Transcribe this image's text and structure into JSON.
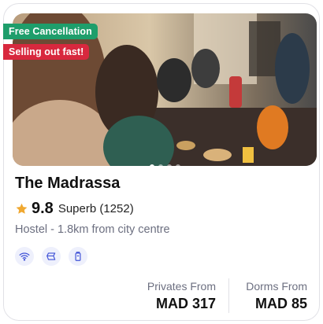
{
  "property": {
    "name": "The Madrassa",
    "rating_score": "9.8",
    "rating_text": "Superb (1252)",
    "meta": "Hostel - 1.8km from city centre"
  },
  "badges": {
    "free_cancellation": "Free Cancellation",
    "selling_out": "Selling out fast!"
  },
  "gallery": {
    "total_images": 4,
    "active_index": 0
  },
  "facilities": [
    {
      "icon": "wifi-icon"
    },
    {
      "icon": "linen-icon"
    },
    {
      "icon": "locker-icon"
    }
  ],
  "prices": {
    "privates_label": "Privates From",
    "privates_value": "MAD 317",
    "dorms_label": "Dorms From",
    "dorms_value": "MAD 85"
  },
  "colors": {
    "badge_green": "#1e9e6b",
    "badge_red": "#d8283e",
    "star": "#f0a830",
    "icon_blue": "#3f51d6"
  }
}
